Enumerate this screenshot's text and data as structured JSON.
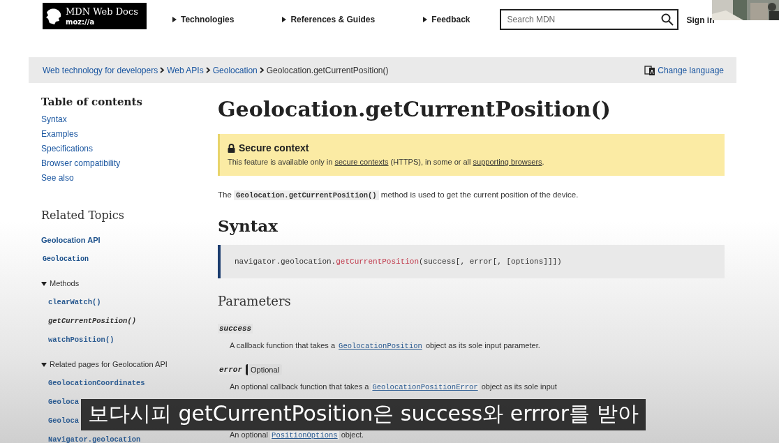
{
  "header": {
    "logo": {
      "title": "MDN Web Docs",
      "subtitle": "moz://a"
    },
    "nav": [
      "Technologies",
      "References & Guides",
      "Feedback"
    ],
    "search": {
      "placeholder": "Search MDN"
    },
    "sign_in": "Sign in",
    "webcam": {
      "kind": "picture"
    }
  },
  "breadcrumbs": {
    "items": [
      {
        "label": "Web technology for developers",
        "link": true
      },
      {
        "label": "Web APIs",
        "link": true
      },
      {
        "label": "Geolocation",
        "link": true
      },
      {
        "label": "Geolocation.getCurrentPosition()",
        "link": false
      }
    ],
    "change_language": "Change language"
  },
  "sidebar": {
    "toc_title": "Table of contents",
    "toc": [
      "Syntax",
      "Examples",
      "Specifications",
      "Browser compatibility",
      "See also"
    ],
    "related_title": "Related Topics",
    "topics": [
      {
        "kind": "heading",
        "label": "Geolocation API"
      },
      {
        "kind": "code-heading",
        "label": "Geolocation"
      }
    ],
    "groups": [
      {
        "label": "Methods",
        "expanded": true,
        "children": [
          {
            "label": "clearWatch()",
            "selected": false
          },
          {
            "label": "getCurrentPosition()",
            "selected": true
          },
          {
            "label": "watchPosition()",
            "selected": false
          }
        ]
      },
      {
        "label": "Related pages for Geolocation API",
        "expanded": true,
        "children": [
          {
            "label": "GeolocationCoordinates",
            "selected": false
          },
          {
            "label": "Geoloca",
            "selected": false
          },
          {
            "label": "Geoloca",
            "selected": false
          },
          {
            "label": "Navigator.geolocation",
            "selected": false
          }
        ]
      }
    ]
  },
  "article": {
    "title": "Geolocation.getCurrentPosition()",
    "notice": {
      "title": "Secure context",
      "parts": [
        {
          "text": "This feature is available only in ",
          "link": false
        },
        {
          "text": "secure contexts",
          "link": true
        },
        {
          "text": " (HTTPS), in some or all ",
          "link": false
        },
        {
          "text": "supporting browsers",
          "link": true
        },
        {
          "text": ".",
          "link": false
        }
      ]
    },
    "intro": {
      "before": "The ",
      "code": "Geolocation.getCurrentPosition()",
      "after": " method is used to get the current position of the device."
    },
    "syntax_title": "Syntax",
    "syntax": {
      "object": "navigator.geolocation.",
      "method": "getCurrentPosition",
      "args": "(success[, error[, [options]]])"
    },
    "parameters_title": "Parameters",
    "parameters": [
      {
        "name": "success",
        "before": "A callback function that takes a ",
        "link": "GeolocationPosition",
        "after": " object as its sole input parameter."
      },
      {
        "name": "error",
        "optional": "Optional",
        "before": "An optional callback function that takes a ",
        "link": "GeolocationPositionError",
        "after": " object as its sole input"
      },
      {
        "before": "An optional ",
        "link": "PositionOptions",
        "after": " object."
      }
    ]
  },
  "subtitle": "보다시피 getCurrentPosition은 success와 errror를 받아"
}
